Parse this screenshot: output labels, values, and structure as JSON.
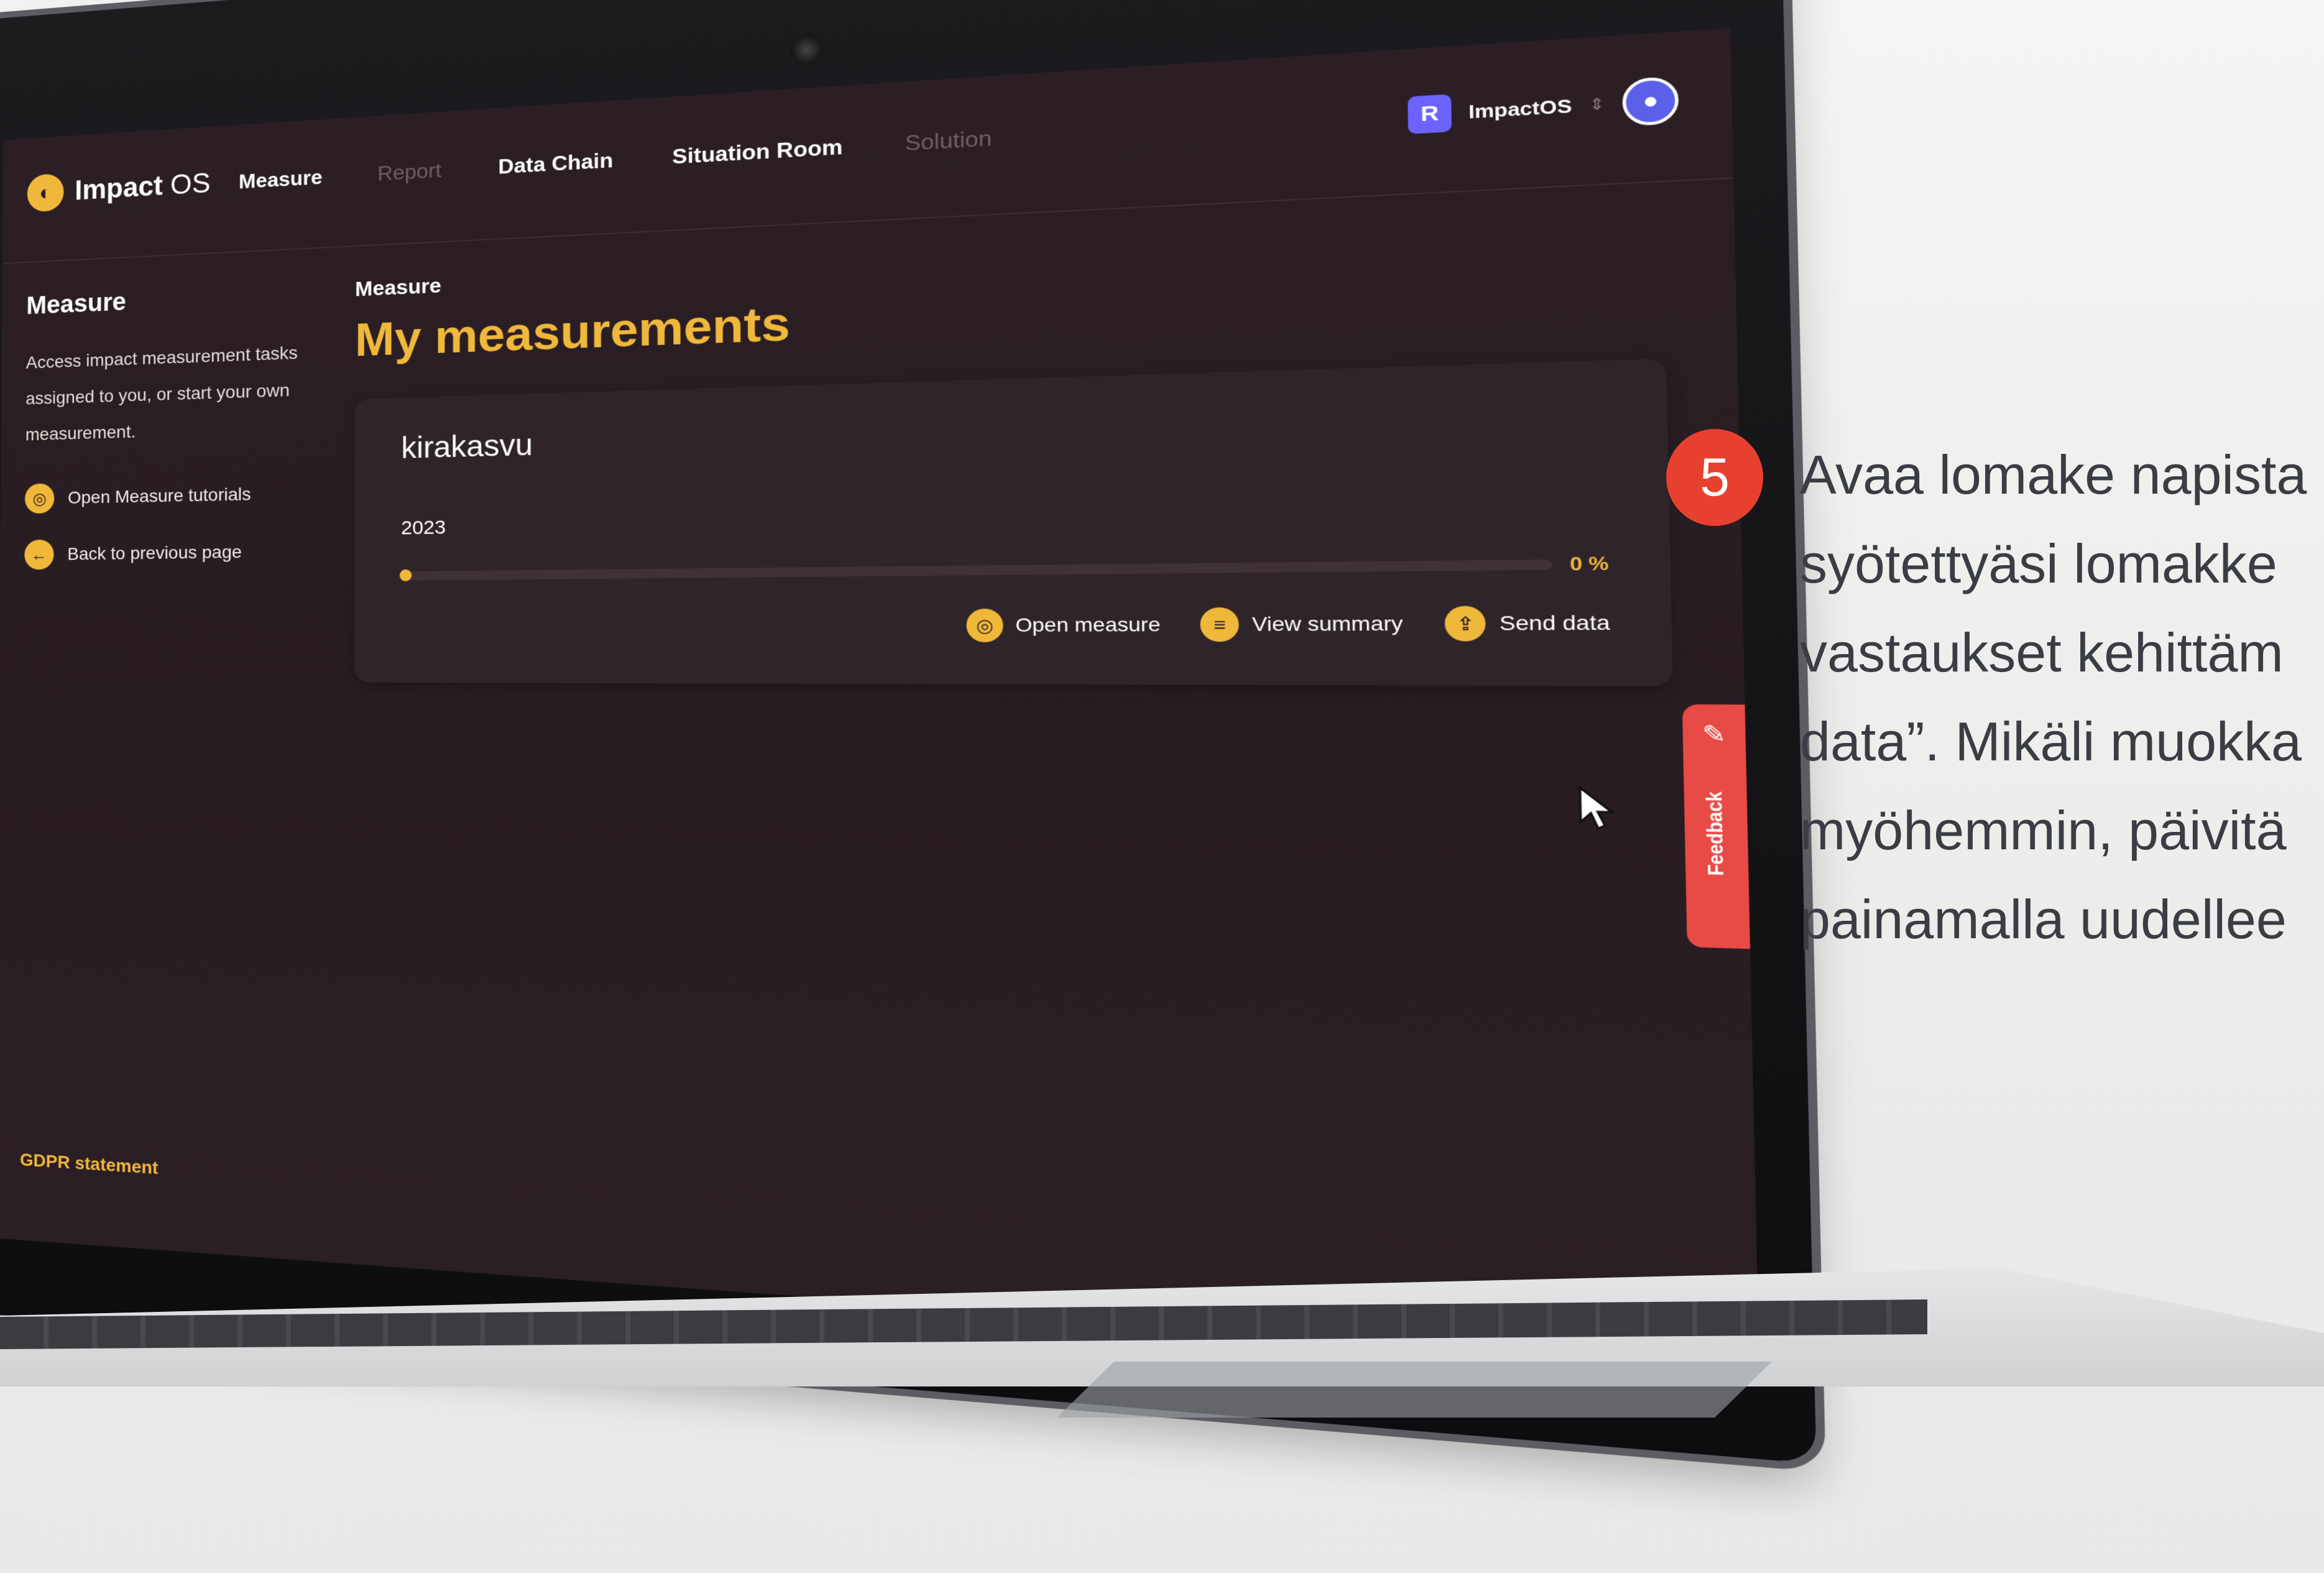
{
  "app": {
    "logo_mark": "◐",
    "logo_name_bold": "Impact",
    "logo_name_rest": " OS"
  },
  "nav": [
    {
      "label": "Measure",
      "enabled": true
    },
    {
      "label": "Report",
      "enabled": false
    },
    {
      "label": "Data Chain",
      "enabled": true
    },
    {
      "label": "Situation Room",
      "enabled": true
    },
    {
      "label": "Solution",
      "enabled": false
    }
  ],
  "account": {
    "org_initial": "R",
    "org_name": "ImpactOS",
    "switch_glyph": "⇕",
    "avatar_glyph": "●"
  },
  "sidebar": {
    "title": "Measure",
    "description": "Access impact measurement tasks assigned to you, or start your own measurement.",
    "links": [
      {
        "label": "Open Measure tutorials",
        "icon": "tutorial-icon",
        "glyph": "◎"
      },
      {
        "label": "Back to previous page",
        "icon": "arrow-left-icon",
        "glyph": "←"
      }
    ],
    "gdpr": "GDPR statement"
  },
  "main": {
    "breadcrumb": "Measure",
    "title": "My measurements",
    "card": {
      "name": "kirakasvu",
      "year": "2023",
      "progress_percent": 0,
      "progress_label": "0 %",
      "actions": [
        {
          "label": "Open measure",
          "icon": "open-icon",
          "glyph": "◎"
        },
        {
          "label": "View summary",
          "icon": "summary-icon",
          "glyph": "≡"
        },
        {
          "label": "Send data",
          "icon": "send-icon",
          "glyph": "⇪"
        }
      ]
    }
  },
  "feedback": {
    "label": "Feedback",
    "glyph": "✎"
  },
  "instructions": {
    "step": "5",
    "lines": [
      "Avaa lomake napista",
      "syötettyäsi lomakke",
      "vastaukset kehittäm",
      "data”. Mikäli muokka",
      "myöhemmin, päivitä",
      "painamalla uudellee"
    ]
  },
  "colors": {
    "accent": "#f0b83a",
    "screen_bg": "#2b1f25",
    "feedback": "#e84a45",
    "step_badge": "#e8402f"
  }
}
